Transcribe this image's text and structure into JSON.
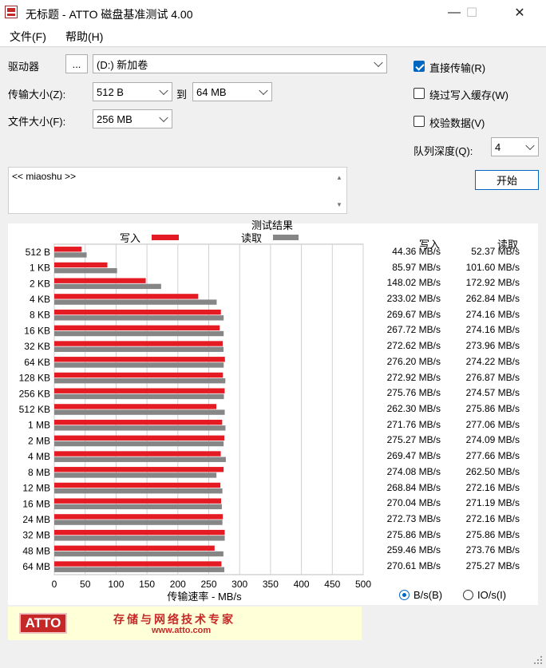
{
  "window": {
    "title": "无标题 - ATTO 磁盘基准测试 4.00",
    "minimize": "—",
    "maximize": "☐",
    "close": "✕"
  },
  "menu": {
    "file": "文件(F)",
    "help": "帮助(H)"
  },
  "form": {
    "drive_label": "驱动器",
    "browse_label": "...",
    "drive_value": "(D:) 新加卷",
    "transfer_label": "传输大小(Z):",
    "transfer_from": "512 B",
    "to_label": "到",
    "transfer_to": "64 MB",
    "file_size_label": "文件大小(F):",
    "file_size": "256 MB",
    "direct_io": {
      "label": "直接传输(R)",
      "checked": true
    },
    "bypass_cache": {
      "label": "绕过写入缓存(W)",
      "checked": false
    },
    "verify_data": {
      "label": "校验数据(V)",
      "checked": false
    },
    "queue_label": "队列深度(Q):",
    "queue_value": "4",
    "start_label": "开始"
  },
  "notes": {
    "text": "<< miaoshu >>"
  },
  "results": {
    "title": "测试结果",
    "write_label": "写入",
    "read_label": "读取",
    "write_header": "写入",
    "read_header": "读取",
    "axis_label": "传输速率 - MB/s",
    "colors": {
      "write": "#e41b23",
      "read": "#868686"
    },
    "unit_bytes": "B/s(B)",
    "unit_io": "IO/s(I)",
    "unit_selected": "B/s(B)"
  },
  "chart_data": {
    "type": "bar",
    "orientation": "horizontal",
    "title": "测试结果",
    "xlabel": "传输速率 - MB/s",
    "xlim": [
      0,
      500
    ],
    "xticks": [
      0,
      50,
      100,
      150,
      200,
      250,
      300,
      350,
      400,
      450,
      500
    ],
    "grid": true,
    "categories": [
      "512 B",
      "1 KB",
      "2 KB",
      "4 KB",
      "8 KB",
      "16 KB",
      "32 KB",
      "64 KB",
      "128 KB",
      "256 KB",
      "512 KB",
      "1 MB",
      "2 MB",
      "4 MB",
      "8 MB",
      "12 MB",
      "16 MB",
      "24 MB",
      "32 MB",
      "48 MB",
      "64 MB"
    ],
    "series": [
      {
        "name": "写入",
        "color": "#e41b23",
        "values": [
          44.36,
          85.97,
          148.02,
          233.02,
          269.67,
          267.72,
          272.62,
          276.2,
          272.92,
          275.76,
          262.3,
          271.76,
          275.27,
          269.47,
          274.08,
          268.84,
          270.04,
          272.73,
          275.86,
          259.46,
          270.61
        ],
        "labels": [
          "44.36 MB/s",
          "85.97 MB/s",
          "148.02 MB/s",
          "233.02 MB/s",
          "269.67 MB/s",
          "267.72 MB/s",
          "272.62 MB/s",
          "276.20 MB/s",
          "272.92 MB/s",
          "275.76 MB/s",
          "262.30 MB/s",
          "271.76 MB/s",
          "275.27 MB/s",
          "269.47 MB/s",
          "274.08 MB/s",
          "268.84 MB/s",
          "270.04 MB/s",
          "272.73 MB/s",
          "275.86 MB/s",
          "259.46 MB/s",
          "270.61 MB/s"
        ]
      },
      {
        "name": "读取",
        "color": "#868686",
        "values": [
          52.37,
          101.6,
          172.92,
          262.84,
          274.16,
          274.16,
          273.96,
          274.22,
          276.87,
          274.57,
          275.86,
          277.06,
          274.09,
          277.66,
          262.5,
          272.16,
          271.19,
          272.16,
          275.86,
          273.76,
          275.27
        ],
        "labels": [
          "52.37 MB/s",
          "101.60 MB/s",
          "172.92 MB/s",
          "262.84 MB/s",
          "274.16 MB/s",
          "274.16 MB/s",
          "273.96 MB/s",
          "274.22 MB/s",
          "276.87 MB/s",
          "274.57 MB/s",
          "275.86 MB/s",
          "277.06 MB/s",
          "274.09 MB/s",
          "277.66 MB/s",
          "262.50 MB/s",
          "272.16 MB/s",
          "271.19 MB/s",
          "272.16 MB/s",
          "275.86 MB/s",
          "273.76 MB/s",
          "275.27 MB/s"
        ]
      }
    ]
  },
  "banner": {
    "logo": "ATTO",
    "slogan": "存储与网络技术专家",
    "url": "www.atto.com"
  }
}
